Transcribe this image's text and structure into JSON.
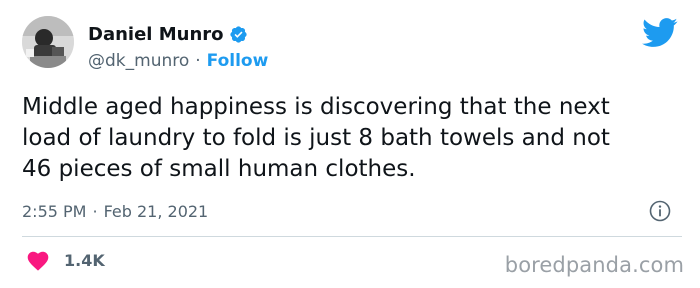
{
  "author": {
    "display_name": "Daniel Munro",
    "handle": "@dk_munro",
    "follow_label": "Follow",
    "verified": true
  },
  "tweet": {
    "lines": [
      "Middle aged happiness is discovering that the next",
      "load of laundry to fold is just 8 bath towels and not",
      "46 pieces of small human clothes."
    ]
  },
  "meta": {
    "time": "2:55 PM",
    "date": "Feb 21, 2021",
    "separator": "·"
  },
  "engagement": {
    "likes": "1.4K"
  },
  "watermark": "boredpanda.com",
  "icons": {
    "brand": "twitter-bird-icon",
    "verified": "verified-badge-icon",
    "info": "info-icon",
    "like": "heart-icon"
  },
  "colors": {
    "accent": "#1d9bf0",
    "heart": "#f91880",
    "secondary_text": "#536471",
    "primary_text": "#0f1419"
  }
}
